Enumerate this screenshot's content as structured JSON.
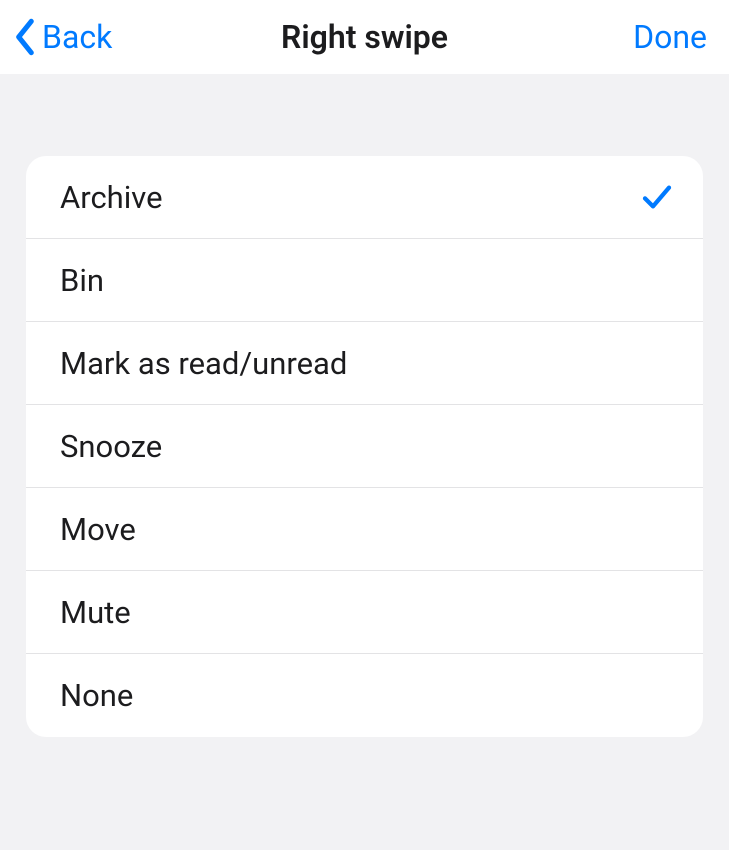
{
  "nav": {
    "back_label": "Back",
    "title": "Right swipe",
    "done_label": "Done"
  },
  "options": [
    {
      "label": "Archive",
      "selected": true
    },
    {
      "label": "Bin",
      "selected": false
    },
    {
      "label": "Mark as read/unread",
      "selected": false
    },
    {
      "label": "Snooze",
      "selected": false
    },
    {
      "label": "Move",
      "selected": false
    },
    {
      "label": "Mute",
      "selected": false
    },
    {
      "label": "None",
      "selected": false
    }
  ]
}
